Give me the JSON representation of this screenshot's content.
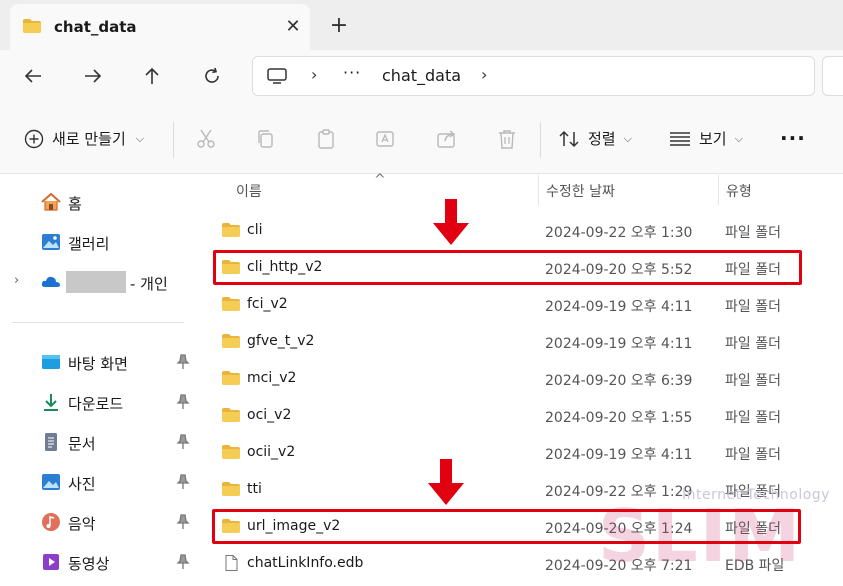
{
  "window": {
    "tab_title": "chat_data",
    "tab_close": "✕",
    "new_tab": "+"
  },
  "address": {
    "dots": "···",
    "sep1": "›",
    "current": "chat_data",
    "sep2": "›"
  },
  "toolbar": {
    "new_label": "새로 만들기",
    "sort_label": "정렬",
    "view_label": "보기",
    "more": "···"
  },
  "sidebar": {
    "home": "홈",
    "gallery": "갤러리",
    "onedrive_suffix": "- 개인",
    "desktop": "바탕 화면",
    "downloads": "다운로드",
    "documents": "문서",
    "pictures": "사진",
    "music": "음악",
    "videos": "동영상"
  },
  "list": {
    "columns": {
      "name": "이름",
      "modified": "수정한 날짜",
      "type": "유형"
    },
    "rows": [
      {
        "name": "cli",
        "modified": "2024-09-22 오후 1:30",
        "type": "파일 폴더"
      },
      {
        "name": "cli_http_v2",
        "modified": "2024-09-20 오후 5:52",
        "type": "파일 폴더"
      },
      {
        "name": "fci_v2",
        "modified": "2024-09-19 오후 4:11",
        "type": "파일 폴더"
      },
      {
        "name": "gfve_t_v2",
        "modified": "2024-09-19 오후 4:11",
        "type": "파일 폴더"
      },
      {
        "name": "mci_v2",
        "modified": "2024-09-20 오후 6:39",
        "type": "파일 폴더"
      },
      {
        "name": "oci_v2",
        "modified": "2024-09-20 오후 1:55",
        "type": "파일 폴더"
      },
      {
        "name": "ocii_v2",
        "modified": "2024-09-19 오후 4:11",
        "type": "파일 폴더"
      },
      {
        "name": "tti",
        "modified": "2024-09-22 오후 1:29",
        "type": "파일 폴더"
      },
      {
        "name": "url_image_v2",
        "modified": "2024-09-20 오후 1:24",
        "type": "파일 폴더"
      },
      {
        "name": "chatLinkInfo.edb",
        "modified": "2024-09-20 오후 7:21",
        "type": "EDB 파일"
      }
    ]
  },
  "watermark": {
    "line1": "Internet Technology",
    "line2": "SLIM"
  },
  "colors": {
    "highlight": "#e0000f",
    "folder": "#f4c74a",
    "accent": "#0067c0"
  }
}
